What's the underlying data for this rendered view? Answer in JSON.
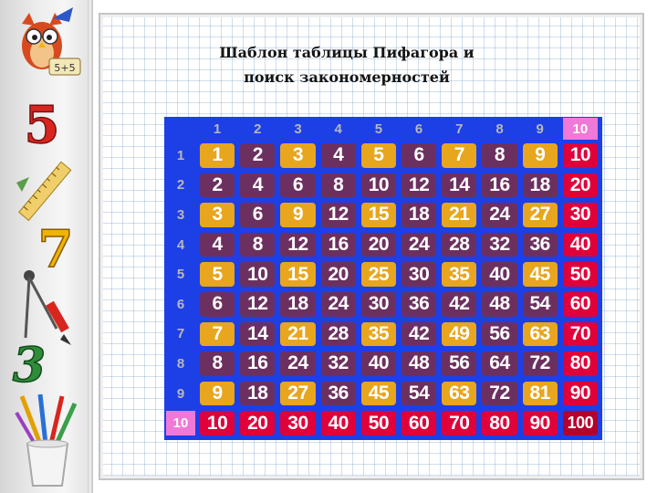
{
  "slide": {
    "title_line1": "Шаблон таблицы Пифагора и",
    "title_line2": "поиск закономерностей"
  },
  "decor": {
    "owl_sign_text": "5+5",
    "digit_top": "5",
    "digit_middle": "7",
    "digit_bottom": "3"
  },
  "colors": {
    "table_bg": "#1d3fe6",
    "cell_default": "#6c3060",
    "cell_odd_product": "#e8a51e",
    "cell_column_10": "#e0003a",
    "cell_corner_100": "#b5002b",
    "header_10_highlight": "#f079d8"
  },
  "table": {
    "col_headers": [
      "1",
      "2",
      "3",
      "4",
      "5",
      "6",
      "7",
      "8",
      "9",
      "10"
    ],
    "row_headers": [
      "1",
      "2",
      "3",
      "4",
      "5",
      "6",
      "7",
      "8",
      "9",
      "10"
    ],
    "rows": [
      [
        "1",
        "2",
        "3",
        "4",
        "5",
        "6",
        "7",
        "8",
        "9",
        "10"
      ],
      [
        "2",
        "4",
        "6",
        "8",
        "10",
        "12",
        "14",
        "16",
        "18",
        "20"
      ],
      [
        "3",
        "6",
        "9",
        "12",
        "15",
        "18",
        "21",
        "24",
        "27",
        "30"
      ],
      [
        "4",
        "8",
        "12",
        "16",
        "20",
        "24",
        "28",
        "32",
        "36",
        "40"
      ],
      [
        "5",
        "10",
        "15",
        "20",
        "25",
        "30",
        "35",
        "40",
        "45",
        "50"
      ],
      [
        "6",
        "12",
        "18",
        "24",
        "30",
        "36",
        "42",
        "48",
        "54",
        "60"
      ],
      [
        "7",
        "14",
        "21",
        "28",
        "35",
        "42",
        "49",
        "56",
        "63",
        "70"
      ],
      [
        "8",
        "16",
        "24",
        "32",
        "40",
        "48",
        "56",
        "64",
        "72",
        "80"
      ],
      [
        "9",
        "18",
        "27",
        "36",
        "45",
        "54",
        "63",
        "72",
        "81",
        "90"
      ],
      [
        "10",
        "20",
        "30",
        "40",
        "50",
        "60",
        "70",
        "80",
        "90",
        "100"
      ]
    ]
  }
}
